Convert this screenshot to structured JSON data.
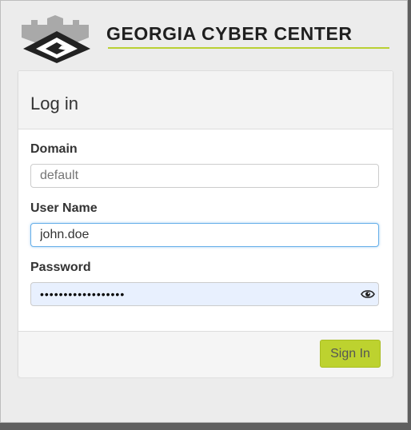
{
  "logo": {
    "text": "GEORGIA CYBER CENTER",
    "mark_icon": "castle-g-logo-icon",
    "accent_color": "#b9d033"
  },
  "panel": {
    "title": "Log in"
  },
  "form": {
    "domain": {
      "label": "Domain",
      "value": "",
      "placeholder": "default"
    },
    "username": {
      "label": "User Name",
      "value": "john.doe"
    },
    "password": {
      "label": "Password",
      "value": "••••••••••••••••••",
      "reveal_icon": "eye-icon"
    }
  },
  "footer": {
    "signin_label": "Sign In",
    "signin_color": "#bdd22f"
  }
}
